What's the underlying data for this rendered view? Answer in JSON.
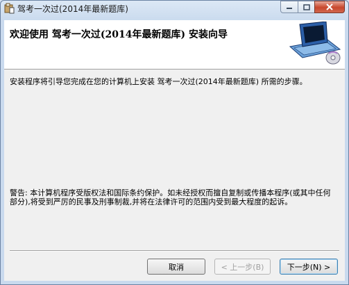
{
  "window": {
    "title": "驾考一次过(2014年最新题库)",
    "controls": [
      "minimize-icon",
      "maximize-icon",
      "close-icon"
    ]
  },
  "banner": {
    "title": "欢迎使用  驾考一次过(2014年最新题库) 安装向导",
    "art_icon": "computer-cd-icon"
  },
  "body": {
    "intro": "安装程序将引导您完成在您的计算机上安装 驾考一次过(2014年最新题库) 所需的步骤。",
    "warning": "警告: 本计算机程序受版权法和国际条约保护。如未经授权而擅自复制或传播本程序(或其中任何部分),将受到严厉的民事及刑事制裁,并将在法律许可的范围内受到最大程度的起诉。"
  },
  "buttons": {
    "cancel": "取消",
    "back": "< 上一步(B)",
    "next": "下一步(N) >"
  }
}
